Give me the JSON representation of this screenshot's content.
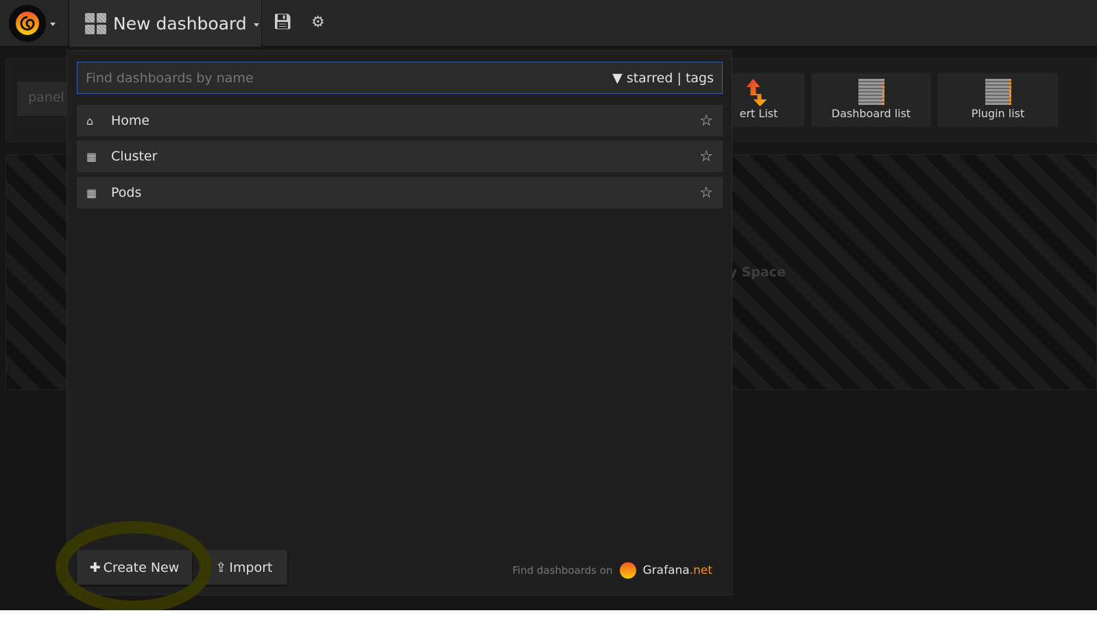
{
  "topbar": {
    "dashboard_title": "New dashboard"
  },
  "background": {
    "panel_label": "panel",
    "tiles": [
      {
        "label": "ert List"
      },
      {
        "label": "Dashboard list"
      },
      {
        "label": "Plugin list"
      }
    ],
    "empty_space": "pty Space"
  },
  "search": {
    "placeholder": "Find dashboards by name",
    "filter_starred": "starred",
    "filter_sep": "|",
    "filter_tags": "tags"
  },
  "dashboards": [
    {
      "name": "Home",
      "icon": "home-icon"
    },
    {
      "name": "Cluster",
      "icon": "grid-icon"
    },
    {
      "name": "Pods",
      "icon": "grid-icon"
    }
  ],
  "buttons": {
    "create_new": "Create New",
    "import": "Import"
  },
  "footer": {
    "text": "Find dashboards on",
    "brand": "Grafana",
    "brand_suffix": ".net"
  },
  "colors": {
    "accent": "#f7941d",
    "focus": "#3c5ea8"
  }
}
